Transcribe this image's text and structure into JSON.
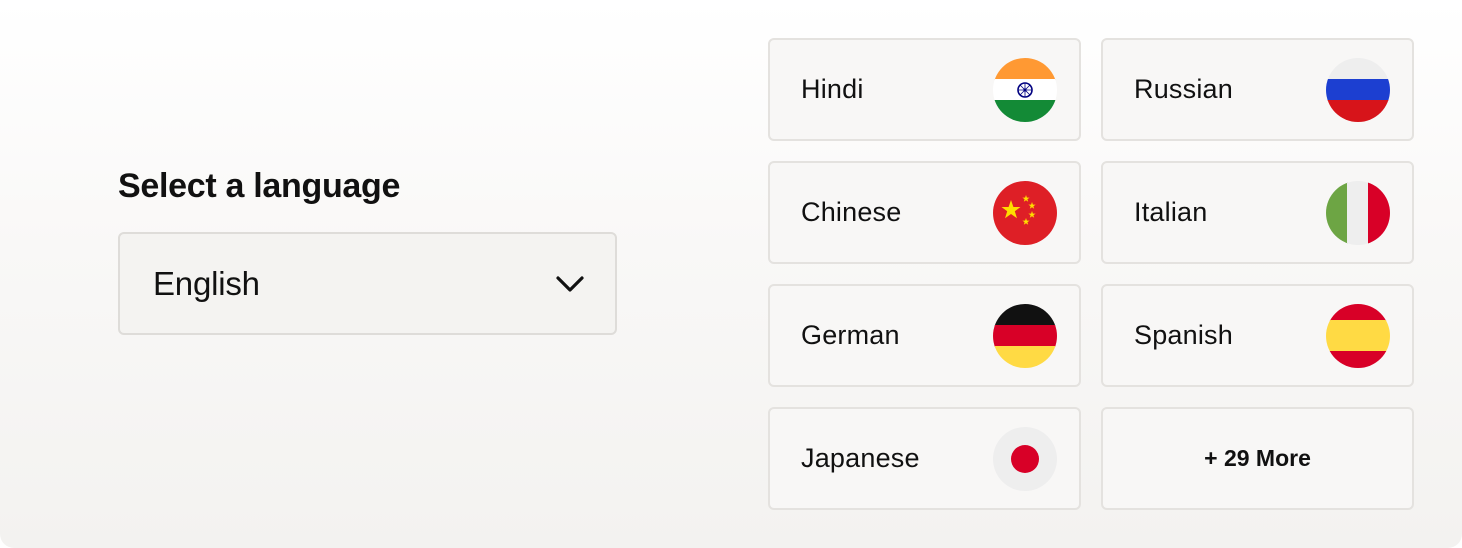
{
  "selector": {
    "title": "Select a language",
    "selected_value": "English",
    "chevron_icon": "chevron-down-icon"
  },
  "languages": [
    {
      "label": "Hindi",
      "flag": "india-flag-icon"
    },
    {
      "label": "Russian",
      "flag": "russia-flag-icon"
    },
    {
      "label": "Chinese",
      "flag": "china-flag-icon"
    },
    {
      "label": "Italian",
      "flag": "italy-flag-icon"
    },
    {
      "label": "German",
      "flag": "germany-flag-icon"
    },
    {
      "label": "Spanish",
      "flag": "spain-flag-icon"
    },
    {
      "label": "Japanese",
      "flag": "japan-flag-icon"
    }
  ],
  "more": {
    "label": "+ 29 More"
  },
  "colors": {
    "text": "#111111",
    "card_border": "#e4e2df",
    "card_background": "#f8f7f6",
    "dropdown_background": "#f4f3f1"
  }
}
